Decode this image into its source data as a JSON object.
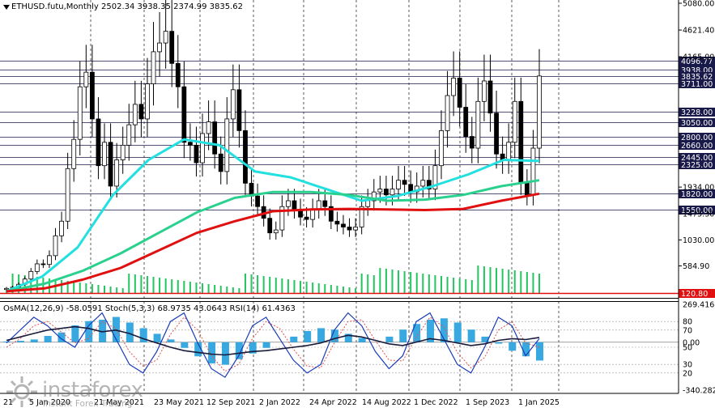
{
  "header": {
    "symbol": "ETHUSD.futu,Monthly",
    "ohlc": "2502.34 3938.35 2374.99 3835.62",
    "oscillators": "OsMA(12,26,9) -58.0591 Stoch(5,3,3) 68.9735 43.0643 RSI(14) 61.4363"
  },
  "watermark": {
    "brand": "instaforex",
    "tagline": "Instant Forex Trading"
  },
  "colors": {
    "price_line": "#000000",
    "ma_fast": "#22e0e0",
    "ma_mid": "#2ad18e",
    "ma_slow": "#e01010",
    "volume": "#22c55e",
    "osma_hist": "#38a8e0",
    "stoch_main": "#1a3bb8",
    "stoch_signal": "#e05050",
    "rsi": "#1a1a3a",
    "level_line": "#1a1a4a",
    "label_box": "#1a1a4a",
    "hl_label": "#e01010"
  },
  "chart_data": [
    {
      "type": "candlestick",
      "title": "ETHUSD.futu,Monthly",
      "ylim": [
        120.8,
        5080.0
      ],
      "y_ticks": [
        "5080.00",
        "4621.40",
        "4165.00",
        "1934.00",
        "1475.30",
        "1030.00",
        "584.90"
      ],
      "x_ticks": [
        "21",
        "5 Jan 2020",
        "21 May 2021",
        "23 May 2021",
        "12 Sep 2021",
        "2 Jan 2022",
        "24 Apr 2022",
        "14 Aug 2022",
        "1 Dec 2022",
        "1 Sep 2023",
        "1 Jan 2025"
      ],
      "levels": [
        "4096.77",
        "3938.00",
        "3835.62",
        "3711.00",
        "3228.00",
        "3050.00",
        "2800.00",
        "2660.00",
        "2445.00",
        "2325.00",
        "1820.00",
        "1550.00",
        "120.80"
      ],
      "highlighted_level": "120.80",
      "series": [
        {
          "name": "price",
          "values": [
            200,
            220,
            270,
            360,
            490,
            620,
            610,
            760,
            1100,
            1350,
            2250,
            2750,
            3650,
            3900,
            3100,
            2300,
            2700,
            1950,
            2400,
            2650,
            3000,
            3350,
            3100,
            3700,
            4250,
            4400,
            4600,
            4050,
            3650,
            2700,
            2650,
            2350,
            2850,
            3050,
            2500,
            2200,
            3100,
            3600,
            2900,
            2000,
            1780,
            1600,
            1400,
            1150,
            1200,
            1600,
            1700,
            1550,
            1420,
            1380,
            1550,
            1700,
            1600,
            1350,
            1300,
            1250,
            1200,
            1250,
            1600,
            1700,
            1850,
            1900,
            1800,
            1900,
            2050,
            1980,
            1850,
            1950,
            2050,
            1900,
            2300,
            2900,
            3500,
            3800,
            3300,
            2800,
            2600,
            3400,
            3750,
            3200,
            2500,
            2400,
            2700,
            3400,
            2000,
            1800,
            2600,
            3835
          ]
        },
        {
          "name": "ma_fast",
          "values": [
            150,
            400,
            900,
            1800,
            2400,
            2750,
            2650,
            2200,
            2100,
            1900,
            1700,
            1780,
            1950,
            2150,
            2400,
            2380
          ]
        },
        {
          "name": "ma_mid",
          "values": [
            150,
            280,
            500,
            800,
            1150,
            1500,
            1750,
            1850,
            1850,
            1800,
            1700,
            1720,
            1800,
            1950,
            2050
          ]
        },
        {
          "name": "ma_slow",
          "values": [
            150,
            200,
            350,
            550,
            850,
            1150,
            1350,
            1520,
            1550,
            1560,
            1550,
            1540,
            1560,
            1700,
            1820
          ]
        }
      ]
    },
    {
      "type": "oscillators",
      "title": "OsMA(12,26,9) Stoch(5,3,3) RSI(14)",
      "ylim": [
        -340.2828,
        269.4165
      ],
      "y_ticks": [
        "269.4165",
        "80",
        "70",
        "0.00",
        "50",
        "30",
        "20",
        "-340.2828"
      ],
      "series": [
        {
          "name": "OsMA",
          "values": [
            5,
            10,
            20,
            45,
            70,
            120,
            150,
            160,
            180,
            140,
            100,
            60,
            20,
            -40,
            -100,
            -150,
            -160,
            -120,
            -80,
            -40,
            0,
            40,
            80,
            100,
            90,
            60,
            30,
            0,
            40,
            90,
            130,
            160,
            170,
            140,
            90,
            40,
            -10,
            -60,
            -100,
            -130
          ]
        },
        {
          "name": "Stoch_main",
          "values": [
            55,
            70,
            85,
            75,
            60,
            50,
            75,
            90,
            60,
            30,
            20,
            45,
            80,
            90,
            55,
            25,
            15,
            40,
            75,
            85,
            60,
            35,
            20,
            30,
            70,
            90,
            75,
            45,
            25,
            40,
            80,
            90,
            60,
            30,
            20,
            50,
            85,
            75,
            40,
            60
          ]
        },
        {
          "name": "Stoch_signal",
          "values": [
            50,
            60,
            75,
            80,
            68,
            55,
            60,
            80,
            72,
            45,
            28,
            35,
            65,
            85,
            70,
            40,
            22,
            30,
            60,
            80,
            72,
            48,
            28,
            26,
            55,
            80,
            82,
            58,
            35,
            34,
            62,
            85,
            74,
            44,
            26,
            38,
            70,
            80,
            55,
            50
          ]
        },
        {
          "name": "RSI",
          "values": [
            58,
            62,
            66,
            70,
            72,
            74,
            72,
            68,
            70,
            66,
            60,
            55,
            50,
            46,
            44,
            42,
            41,
            43,
            45,
            46,
            48,
            50,
            52,
            55,
            60,
            64,
            62,
            58,
            54,
            52,
            56,
            60,
            58,
            55,
            52,
            54,
            58,
            60,
            59,
            61.4363
          ]
        }
      ]
    }
  ]
}
